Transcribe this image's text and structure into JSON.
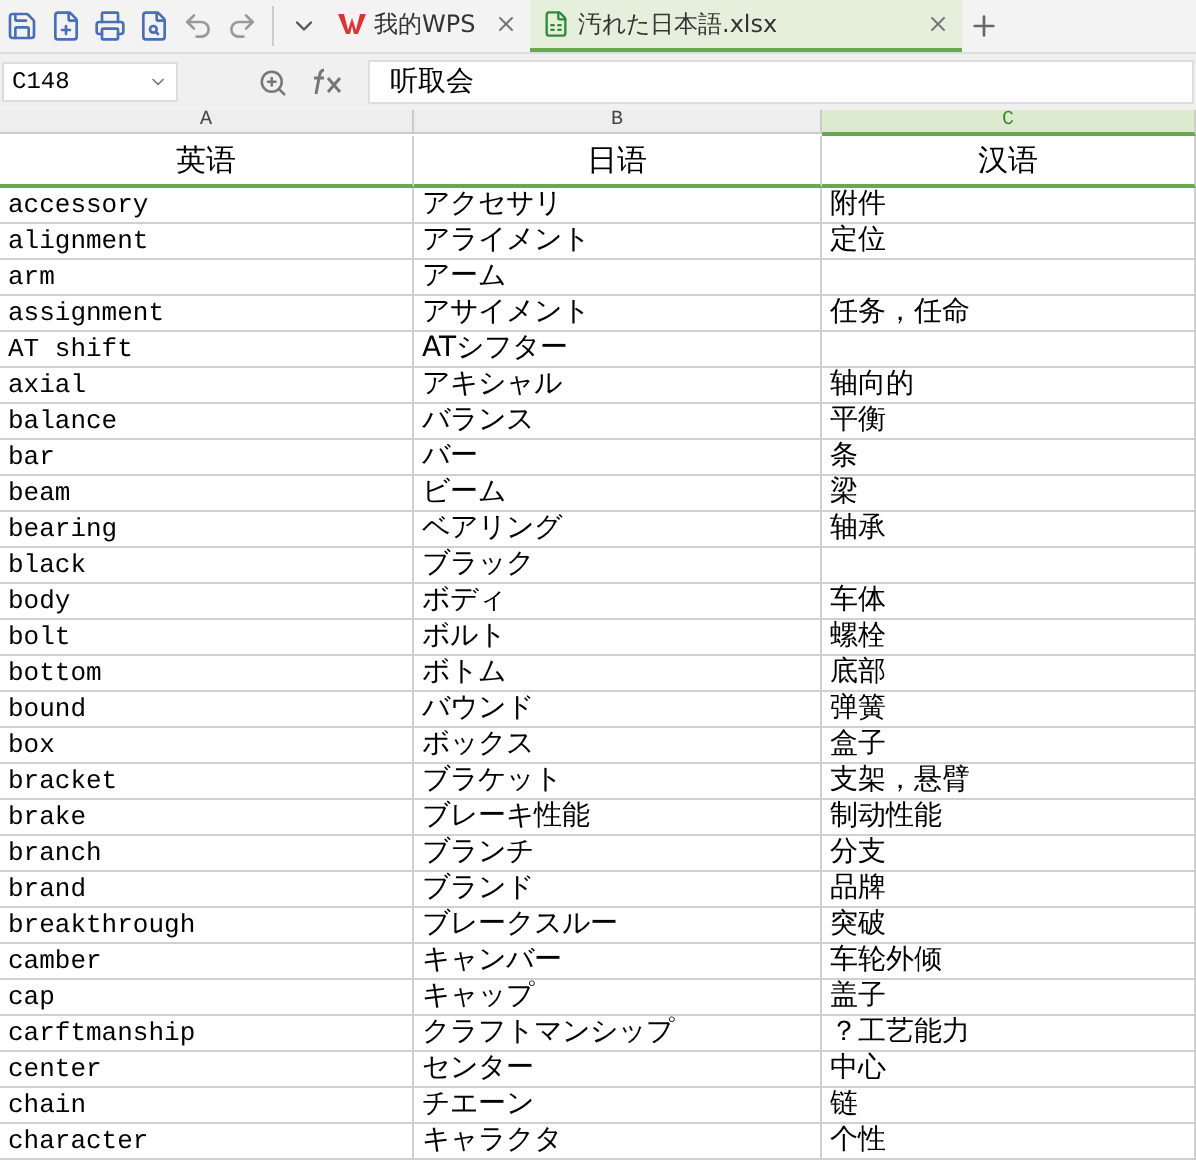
{
  "tabs": [
    {
      "label": "我的WPS",
      "kind": "home",
      "selected": false
    },
    {
      "label": "汚れた日本語.xlsx",
      "kind": "sheet",
      "selected": true
    }
  ],
  "formula_bar": {
    "cell_ref": "C148",
    "formula": "听取会"
  },
  "columns": [
    {
      "letter": "A",
      "selected": false
    },
    {
      "letter": "B",
      "selected": false
    },
    {
      "letter": "C",
      "selected": true
    }
  ],
  "header_row": [
    "英语",
    "日语",
    "汉语"
  ],
  "rows": [
    [
      "accessory",
      "アクセサリ",
      "附件"
    ],
    [
      "alignment",
      "アライメント",
      "定位"
    ],
    [
      "arm",
      "アーム",
      ""
    ],
    [
      "assignment",
      "アサイメント",
      "任务，任命"
    ],
    [
      "AT shift",
      "ATシフター",
      ""
    ],
    [
      "axial",
      "アキシャル",
      "轴向的"
    ],
    [
      "balance",
      "バランス",
      "平衡"
    ],
    [
      "bar",
      "バー",
      "条"
    ],
    [
      "beam",
      "ビーム",
      "梁"
    ],
    [
      "bearing",
      "ベアリング",
      "轴承"
    ],
    [
      "black",
      "ブラック",
      ""
    ],
    [
      "body",
      "ボディ",
      "车体"
    ],
    [
      "bolt",
      "ボルト",
      "螺栓"
    ],
    [
      "bottom",
      "ボトム",
      "底部"
    ],
    [
      "bound",
      "バウンド",
      "弹簧"
    ],
    [
      "box",
      "ボックス",
      "盒子"
    ],
    [
      "bracket",
      "ブラケット",
      "支架，悬臂"
    ],
    [
      "brake",
      "ブレーキ性能",
      "制动性能"
    ],
    [
      "branch",
      "ブランチ",
      "分支"
    ],
    [
      "brand",
      "ブランド",
      "品牌"
    ],
    [
      "breakthrough",
      "ブレークスルー",
      "突破"
    ],
    [
      "camber",
      "キャンバー",
      "车轮外倾"
    ],
    [
      "cap",
      "キャップ",
      "盖子"
    ],
    [
      "carftmanship",
      "クラフトマンシップ",
      "？工艺能力"
    ],
    [
      "center",
      "センター",
      "中心"
    ],
    [
      "chain",
      "チエーン",
      "链"
    ],
    [
      "character",
      "キャラクタ",
      "个性"
    ]
  ]
}
